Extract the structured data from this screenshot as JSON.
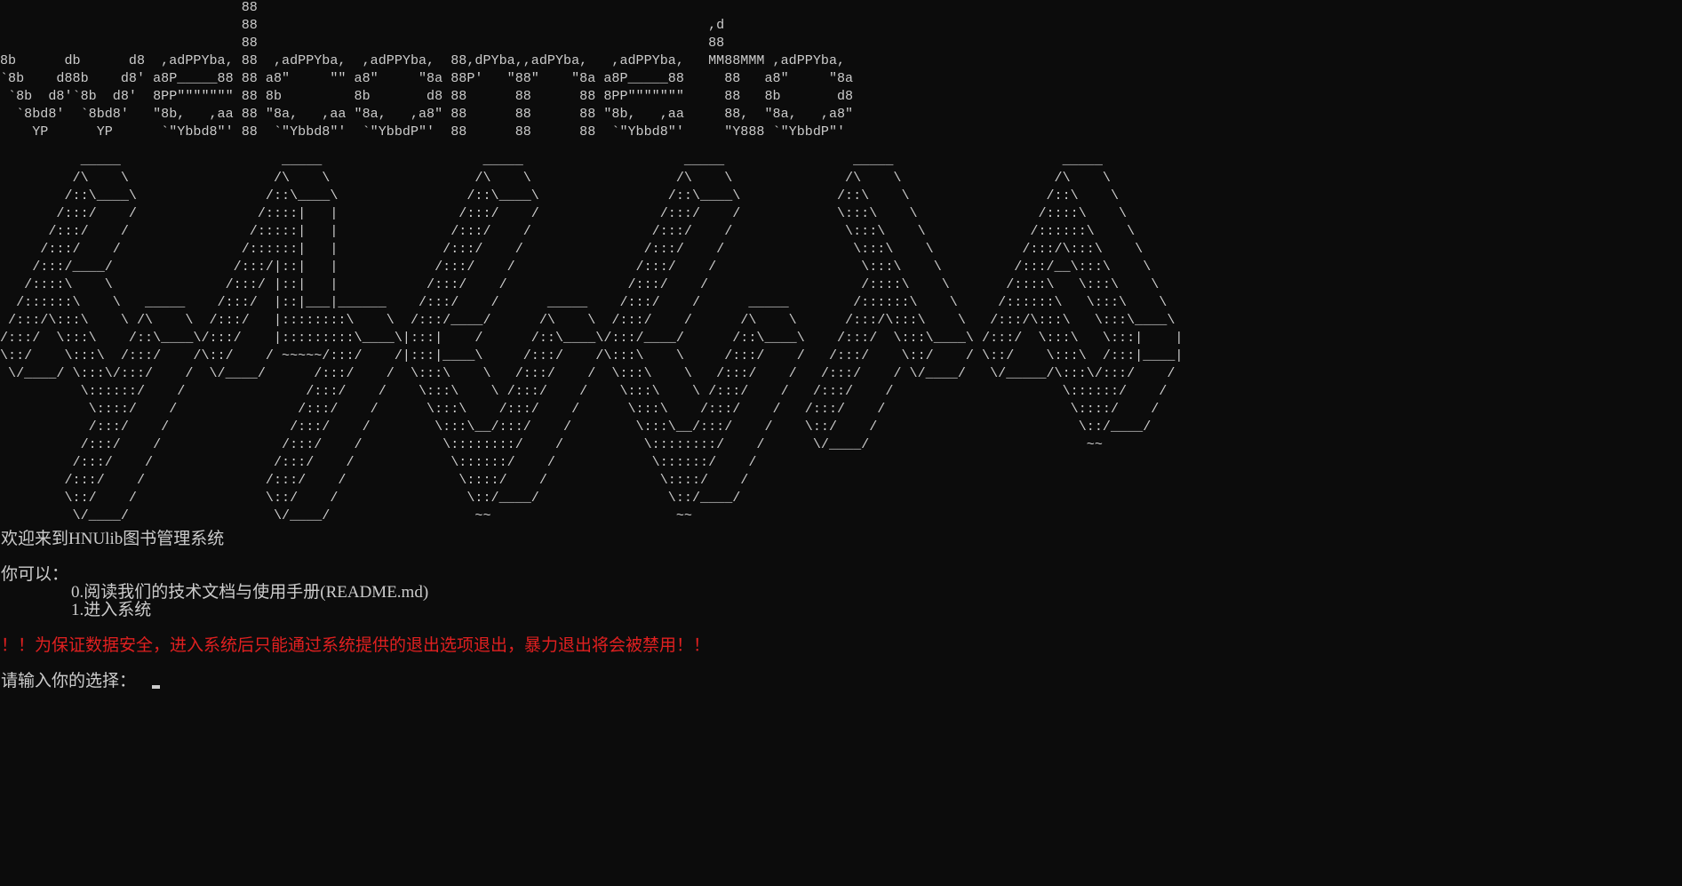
{
  "terminal": {
    "banner_text": "                              88\n                              88                                                        ,d\n                              88                                                        88\n8b      db      d8  ,adPPYba, 88  ,adPPYba,  ,adPPYba,  88,dPYba,,adPYba,   ,adPPYba,   MM88MMM ,adPPYba,\n`8b    d88b    d8' a8P_____88 88 a8\"     \"\" a8\"     \"8a 88P'   \"88\"    \"8a a8P_____88     88   a8\"     \"8a\n `8b  d8'`8b  d8'  8PP\"\"\"\"\"\"\" 88 8b         8b       d8 88      88      88 8PP\"\"\"\"\"\"\"     88   8b       d8\n  `8bd8'  `8bd8'   \"8b,   ,aa 88 \"8a,   ,aa \"8a,   ,a8\" 88      88      88 \"8b,   ,aa     88,  \"8a,   ,a8\"\n    YP      YP      `\"Ybbd8\"' 88  `\"Ybbd8\"'  `\"YbbdP\"'  88      88      88  `\"Ybbd8\"'     \"Y888 `\"YbbdP\"'",
    "banner_art": "          _____                    _____                    _____                    _____                _____                     _____\n         /\\    \\                  /\\    \\                  /\\    \\                  /\\    \\              /\\    \\                   /\\    \\\n        /::\\____\\                /::\\____\\                /::\\____\\                /::\\____\\            /::\\    \\                 /::\\    \\\n       /:::/    /               /::::|   |               /:::/    /               /:::/    /            \\:::\\    \\               /::::\\    \\\n      /:::/    /               /:::::|   |              /:::/    /               /:::/    /              \\:::\\    \\             /::::::\\    \\\n     /:::/    /               /::::::|   |             /:::/    /               /:::/    /                \\:::\\    \\           /:::/\\:::\\    \\\n    /:::/____/               /:::/|::|   |            /:::/    /               /:::/    /                  \\:::\\    \\         /:::/__\\:::\\    \\\n   /::::\\    \\              /:::/ |::|   |           /:::/    /               /:::/    /                   /::::\\    \\       /::::\\   \\:::\\    \\\n  /::::::\\    \\   _____    /:::/  |::|___|______    /:::/    /      _____    /:::/    /      _____        /::::::\\    \\     /::::::\\   \\:::\\    \\\n /:::/\\:::\\    \\ /\\    \\  /:::/   |::::::::\\    \\  /:::/____/      /\\    \\  /:::/    /      /\\    \\      /:::/\\:::\\    \\   /:::/\\:::\\   \\:::\\____\\\n/:::/  \\:::\\    /::\\____\\/:::/    |:::::::::\\____\\|:::|    /      /::\\____\\/:::/____/      /::\\____\\    /:::/  \\:::\\____\\ /:::/  \\:::\\   \\:::|    |\n\\::/    \\:::\\  /:::/    /\\::/    / ~~~~~/:::/    /|:::|____\\     /:::/    /\\:::\\    \\     /:::/    /   /:::/    \\::/    / \\::/    \\:::\\  /:::|____|\n \\/____/ \\:::\\/:::/    /  \\/____/      /:::/    /  \\:::\\    \\   /:::/    /  \\:::\\    \\   /:::/    /   /:::/    / \\/____/   \\/_____/\\:::\\/:::/    /\n          \\::::::/    /               /:::/    /    \\:::\\    \\ /:::/    /    \\:::\\    \\ /:::/    /   /:::/    /                     \\::::::/    /\n           \\::::/    /               /:::/    /      \\:::\\    /:::/    /      \\:::\\    /:::/    /   /:::/    /                       \\::::/    /\n           /:::/    /               /:::/    /        \\:::\\__/:::/    /        \\:::\\__/:::/    /    \\::/    /                         \\::/____/\n          /:::/    /               /:::/    /          \\::::::::/    /          \\::::::::/    /      \\/____/                           ~~\n         /:::/    /               /:::/    /            \\::::::/    /            \\::::::/    /\n        /:::/    /               /:::/    /              \\::::/    /              \\::::/    /\n        \\::/    /                \\::/    /                \\::/____/                \\::/____/\n         \\/____/                  \\/____/                  ~~                       ~~",
    "welcome": "欢迎来到HNUlib图书管理系统",
    "you_can": "你可以：",
    "option_0": "0.阅读我们的技术文档与使用手册(README.md)",
    "option_1": "1.进入系统",
    "warning": "！！为保证数据安全，进入系统后只能通过系统提供的退出选项退出，暴力退出将会被禁用！！",
    "prompt": "请输入你的选择："
  },
  "colors": {
    "background": "#0c0c0c",
    "text": "#cccccc",
    "warning": "#e02020"
  }
}
